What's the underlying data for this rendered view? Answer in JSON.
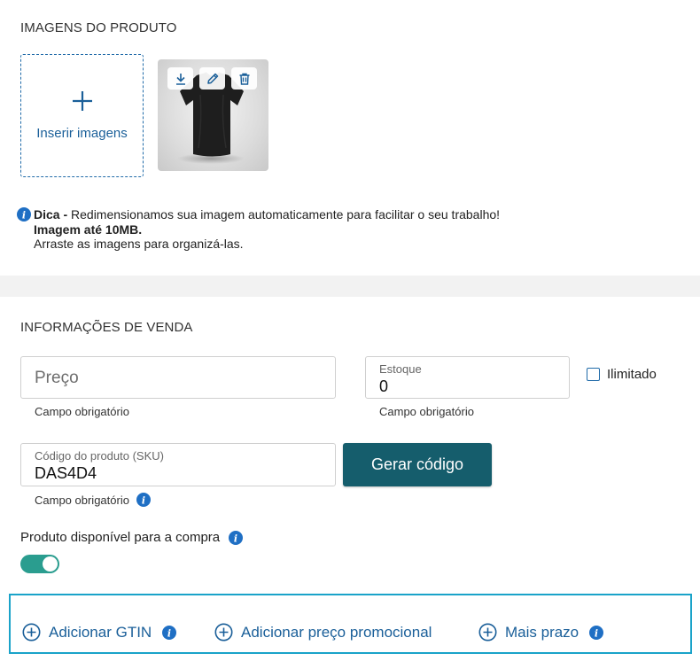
{
  "images_section": {
    "title": "IMAGENS DO PRODUTO",
    "upload_label": "Inserir imagens",
    "thumbnail": {
      "actions": [
        "download-icon",
        "edit-icon",
        "delete-icon"
      ]
    },
    "tip": {
      "bold_prefix": "Dica -",
      "text": " Redimensionamos sua imagem automaticamente para facilitar o seu trabalho!",
      "line2": "Imagem até 10MB.",
      "line3": "Arraste as imagens para organizá-las."
    }
  },
  "sales_section": {
    "title": "INFORMAÇÕES DE VENDA",
    "price": {
      "placeholder": "Preço",
      "helper": "Campo obrigatório"
    },
    "stock": {
      "label": "Estoque",
      "value": "0",
      "helper": "Campo obrigatório"
    },
    "unlimited_label": "Ilimitado",
    "sku": {
      "label": "Código do produto (SKU)",
      "value": "DAS4D4",
      "helper": "Campo obrigatório"
    },
    "generate_button": "Gerar código",
    "available_label": "Produto disponível para a compra",
    "available_on": true
  },
  "extras": {
    "gtin": "Adicionar GTIN",
    "promo": "Adicionar preço promocional",
    "term": "Mais prazo"
  },
  "colors": {
    "primary_blue": "#1a5f99",
    "info_blue": "#1f6fc4",
    "button_teal": "#155d6c",
    "toggle_teal": "#2a9d8f",
    "extras_border": "#1aa3c9"
  }
}
